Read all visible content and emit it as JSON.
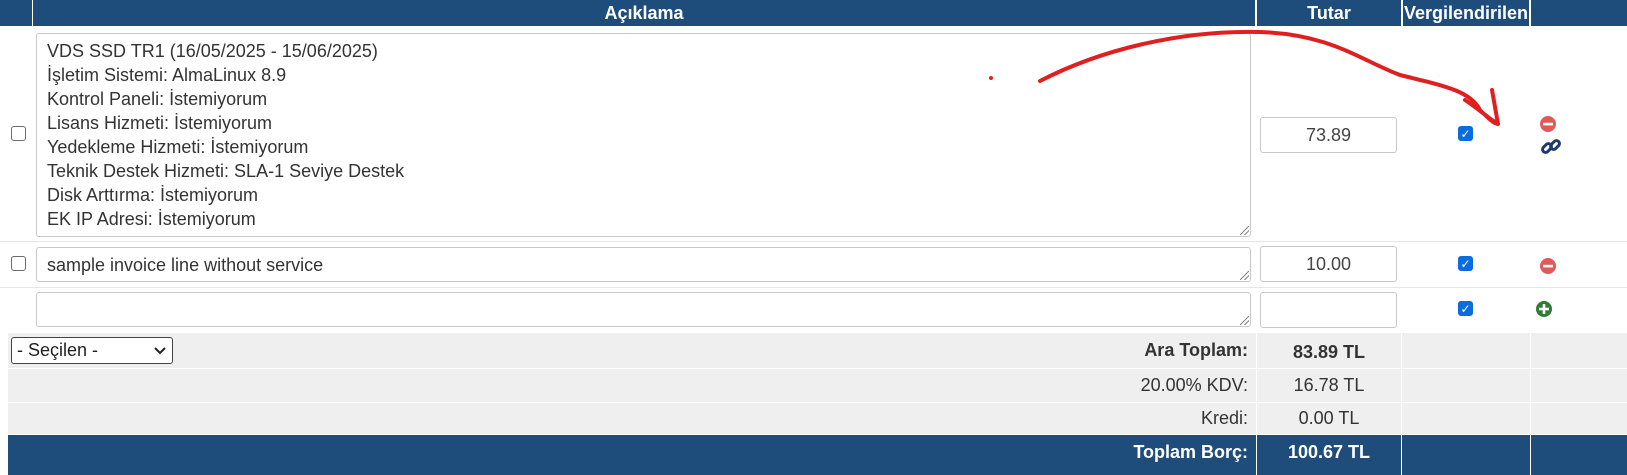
{
  "header": {
    "description": "Açıklama",
    "amount": "Tutar",
    "taxed": "Vergilendirilen"
  },
  "items": [
    {
      "description_lines": "VDS SSD TR1 (16/05/2025 - 15/06/2025)\nİşletim Sistemi: AlmaLinux 8.9\nKontrol Paneli: İstemiyorum\nLisans Hizmeti: İstemiyorum\nYedekleme Hizmeti: İstemiyorum\nTeknik Destek Hizmeti: SLA-1 Seviye Destek\nDisk Arttırma: İstemiyorum\nEK IP Adresi: İstemiyorum",
      "amount": "73.89",
      "taxed": true
    },
    {
      "description_lines": "sample invoice line without service",
      "amount": "10.00",
      "taxed": true
    },
    {
      "description_lines": "",
      "amount": "",
      "taxed": true
    }
  ],
  "bulk_select": {
    "value": "- Seçilen -"
  },
  "totals": {
    "subtotal_label": "Ara Toplam:",
    "subtotal_value": "83.89 TL",
    "tax_label": "20.00% KDV:",
    "tax_value": "16.78 TL",
    "credit_label": "Kredi:",
    "credit_value": "0.00 TL",
    "total_label": "Toplam Borç:",
    "total_value": "100.67 TL"
  },
  "colors": {
    "header": "#1e4d7b",
    "remove": "#e05a5a",
    "add": "#2e7d32",
    "annotation": "#e02020"
  },
  "icons": [
    "remove-icon",
    "link-icon",
    "add-icon"
  ]
}
